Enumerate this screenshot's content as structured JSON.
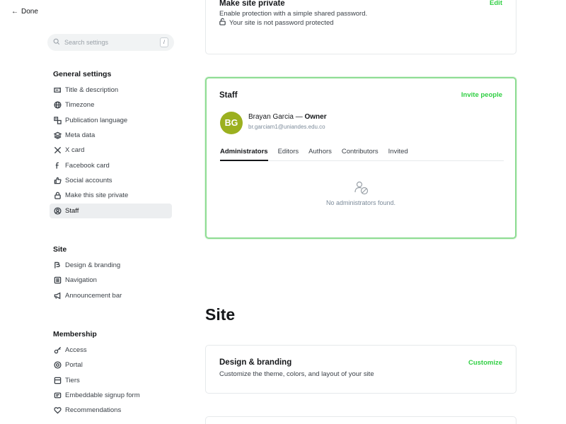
{
  "header": {
    "done_label": "Done"
  },
  "search": {
    "placeholder": "Search settings",
    "shortcut": "/"
  },
  "sidebar": {
    "general": {
      "title": "General settings",
      "items": [
        {
          "label": "Title & description",
          "icon": "text-box-icon"
        },
        {
          "label": "Timezone",
          "icon": "globe-icon"
        },
        {
          "label": "Publication language",
          "icon": "language-icon"
        },
        {
          "label": "Meta data",
          "icon": "layers-icon"
        },
        {
          "label": "X card",
          "icon": "x-logo-icon"
        },
        {
          "label": "Facebook card",
          "icon": "facebook-icon"
        },
        {
          "label": "Social accounts",
          "icon": "thumbs-up-icon"
        },
        {
          "label": "Make this site private",
          "icon": "lock-icon"
        },
        {
          "label": "Staff",
          "icon": "staff-icon",
          "active": true
        }
      ]
    },
    "site": {
      "title": "Site",
      "items": [
        {
          "label": "Design & branding",
          "icon": "brush-icon"
        },
        {
          "label": "Navigation",
          "icon": "navigation-icon"
        },
        {
          "label": "Announcement bar",
          "icon": "megaphone-icon"
        }
      ]
    },
    "membership": {
      "title": "Membership",
      "items": [
        {
          "label": "Access",
          "icon": "key-icon"
        },
        {
          "label": "Portal",
          "icon": "portal-icon"
        },
        {
          "label": "Tiers",
          "icon": "tiers-icon"
        },
        {
          "label": "Embeddable signup form",
          "icon": "embed-icon"
        },
        {
          "label": "Recommendations",
          "icon": "heart-icon"
        }
      ]
    }
  },
  "private_card": {
    "title": "Make site private",
    "subtitle": "Enable protection with a simple shared password.",
    "edit_label": "Edit",
    "status": "Your site is not password protected"
  },
  "staff_card": {
    "title": "Staff",
    "invite_label": "Invite people",
    "owner": {
      "initials": "BG",
      "name": "Brayan Garcia",
      "separator": "—",
      "role": "Owner",
      "email": "br.garciam1@uniandes.edu.co",
      "avatar_color": "#9bb01f"
    },
    "tabs": [
      "Administrators",
      "Editors",
      "Authors",
      "Contributors",
      "Invited"
    ],
    "active_tab": "Administrators",
    "empty_text": "No administrators found."
  },
  "site_section": {
    "heading": "Site",
    "design_card": {
      "title": "Design & branding",
      "subtitle": "Customize the theme, colors, and layout of your site",
      "action_label": "Customize"
    }
  },
  "colors": {
    "accent": "#30cf43",
    "highlight_border": "#8fdd94"
  }
}
